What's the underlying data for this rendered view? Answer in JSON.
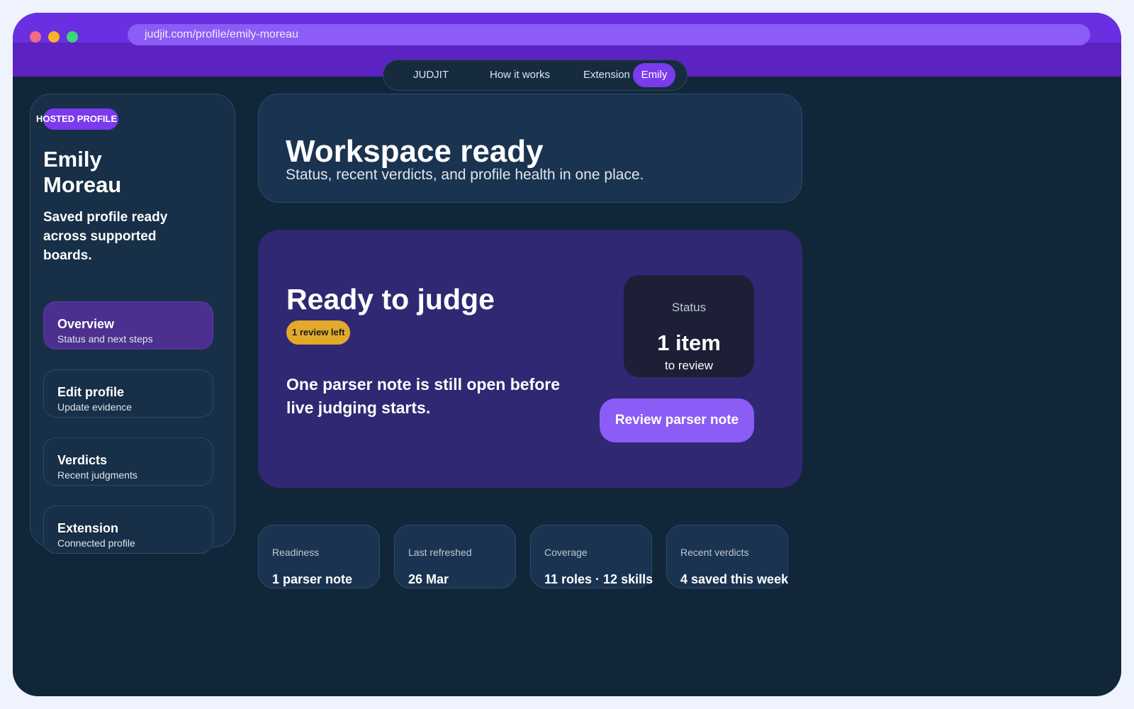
{
  "browser": {
    "url": "judjit.com/profile/emily-moreau"
  },
  "topnav": {
    "brand": "JUDJIT",
    "how_it_works": "How it works",
    "extension": "Extension",
    "user": "Emily"
  },
  "sidebar": {
    "badge": "HOSTED PROFILE",
    "name_first": "Emily",
    "name_last": "Moreau",
    "description": "Saved profile ready across supported boards.",
    "items": [
      {
        "title": "Overview",
        "subtitle": "Status and next steps",
        "active": true
      },
      {
        "title": "Edit profile",
        "subtitle": "Update evidence",
        "active": false
      },
      {
        "title": "Verdicts",
        "subtitle": "Recent judgments",
        "active": false
      },
      {
        "title": "Extension",
        "subtitle": "Connected profile",
        "active": false
      }
    ]
  },
  "hero": {
    "title": "Workspace ready",
    "subtitle": "Status, recent verdicts, and profile health in one place."
  },
  "judge": {
    "title": "Ready to judge",
    "badge": "1 review left",
    "message": "One parser note is still open before live judging starts.",
    "status_label": "Status",
    "status_value": "1 item",
    "status_sub": "to review",
    "button": "Review parser note"
  },
  "stats": [
    {
      "label": "Readiness",
      "value": "1 parser note"
    },
    {
      "label": "Last refreshed",
      "value": "26 Mar"
    },
    {
      "label": "Coverage",
      "value": "11 roles · 12 skills"
    },
    {
      "label": "Recent verdicts",
      "value": "4 saved this week"
    }
  ],
  "colors": {
    "accent": "#7c3aed",
    "accent_light": "#8b5cf6",
    "warning_badge": "#e2a92b",
    "background": "#12263a",
    "judge_card": "#312873"
  }
}
